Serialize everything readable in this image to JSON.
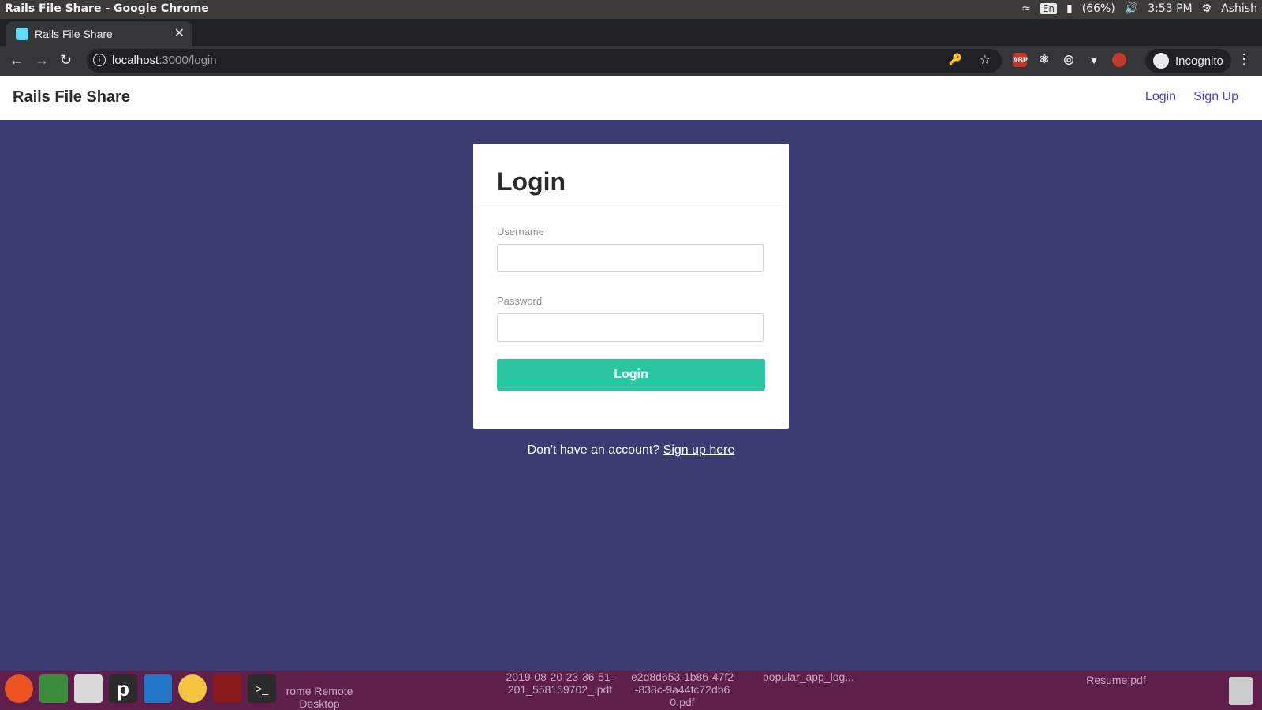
{
  "system_bar": {
    "window_title": "Rails File Share - Google Chrome",
    "lang": "En",
    "battery": "(66%)",
    "time": "3:53 PM",
    "user": "Ashish"
  },
  "browser": {
    "tab_title": "Rails File Share",
    "url_host": "localhost",
    "url_path": ":3000/login",
    "incognito_label": "Incognito",
    "extensions": [
      "ABP",
      "react-devtools",
      "target",
      "vue-devtools",
      "redux"
    ]
  },
  "navbar": {
    "brand": "Rails File Share",
    "login_link": "Login",
    "signup_link": "Sign Up"
  },
  "login_card": {
    "title": "Login",
    "username_label": "Username",
    "username_value": "",
    "password_label": "Password",
    "password_value": "",
    "submit_label": "Login"
  },
  "signup_prompt": {
    "text": "Don't have an account?",
    "link": "Sign up here"
  },
  "taskbar": {
    "desktop_items": [
      "rome Remote Desktop",
      "2019-08-20-23-36-51-201_558159702_.pdf",
      "e2d8d653-1b86-47f2-838c-9a44fc72db60.pdf",
      "popular_app_log...",
      "Resume.pdf"
    ]
  },
  "colors": {
    "page_bg": "#3b3d72",
    "accent": "#2ac6a1",
    "link": "#4a3fd1",
    "taskbar": "#5e1f4d"
  }
}
